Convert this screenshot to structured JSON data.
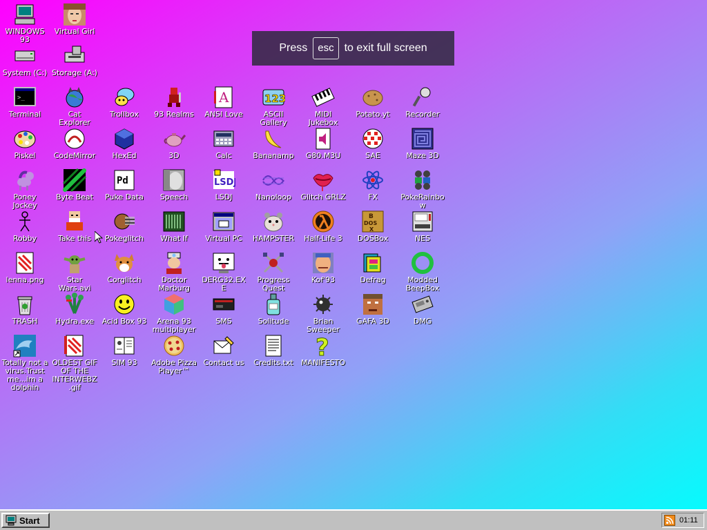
{
  "fullscreen_notice": {
    "prefix": "Press",
    "key": "esc",
    "suffix": "to exit full screen"
  },
  "taskbar": {
    "start_label": "Start",
    "clock": "01:11"
  },
  "desktop_icons": [
    {
      "name": "icon-windows93",
      "label": "WINDOWS 93",
      "icon": "computer-icon"
    },
    {
      "name": "icon-virtual-girl",
      "label": "Virtual Girl",
      "icon": "girl-face-icon"
    },
    {
      "name": "icon-system-c",
      "label": "System (C:)",
      "icon": "hard-drive-icon"
    },
    {
      "name": "icon-storage-a",
      "label": "Storage (A:)",
      "icon": "floppy-drive-icon"
    },
    {
      "name": "icon-terminal",
      "label": "Terminal",
      "icon": "terminal-icon"
    },
    {
      "name": "icon-cat-explorer",
      "label": "Cat Explorer",
      "icon": "cat-globe-icon"
    },
    {
      "name": "icon-trollbox",
      "label": "Trollbox",
      "icon": "chat-bubble-icon"
    },
    {
      "name": "icon-93-realms",
      "label": "93 Realms",
      "icon": "knight-icon"
    },
    {
      "name": "icon-ansi-love",
      "label": "ANSI Love",
      "icon": "ansi-letter-icon"
    },
    {
      "name": "icon-ascii-gallery",
      "label": "ASCII Gallery",
      "icon": "ascii-123-icon"
    },
    {
      "name": "icon-midi-jukebox",
      "label": "MIDI Jukebox",
      "icon": "piano-keys-icon"
    },
    {
      "name": "icon-potato-yt",
      "label": "Potato.yt",
      "icon": "potato-icon"
    },
    {
      "name": "icon-recorder",
      "label": "Recorder",
      "icon": "microphone-icon"
    },
    {
      "name": "icon-piskel",
      "label": "Piskel",
      "icon": "palette-icon"
    },
    {
      "name": "icon-codemirror",
      "label": "CodeMirror",
      "icon": "codemirror-icon"
    },
    {
      "name": "icon-hexed",
      "label": "HexEd",
      "icon": "hex-cube-icon"
    },
    {
      "name": "icon-3d",
      "label": "3D",
      "icon": "teapot-icon"
    },
    {
      "name": "icon-calc",
      "label": "Calc",
      "icon": "calculator-icon"
    },
    {
      "name": "icon-bananamp",
      "label": "Bananamp",
      "icon": "banana-icon"
    },
    {
      "name": "icon-g80-m3u",
      "label": "G80.M3U",
      "icon": "audio-file-icon"
    },
    {
      "name": "icon-sae",
      "label": "SAE",
      "icon": "checkered-ball-icon"
    },
    {
      "name": "icon-maze-3d",
      "label": "Maze 3D",
      "icon": "maze-icon"
    },
    {
      "name": "icon-poney-jockey",
      "label": "Poney Jockey",
      "icon": "pony-icon"
    },
    {
      "name": "icon-byte-beat",
      "label": "Byte Beat",
      "icon": "byte-beat-icon"
    },
    {
      "name": "icon-puke-data",
      "label": "Puke Data",
      "icon": "pd-icon"
    },
    {
      "name": "icon-speech",
      "label": "Speech",
      "icon": "speech-face-icon"
    },
    {
      "name": "icon-lsdj",
      "label": "LSDJ",
      "icon": "lsdj-icon"
    },
    {
      "name": "icon-nanoloop",
      "label": "Nanoloop",
      "icon": "wave-icon"
    },
    {
      "name": "icon-glitch-grlz",
      "label": "Glitch GRLZ",
      "icon": "lips-icon"
    },
    {
      "name": "icon-fx",
      "label": "FX",
      "icon": "atom-icon"
    },
    {
      "name": "icon-pokerainbow",
      "label": "PokeRainbow",
      "icon": "trainers-icon"
    },
    {
      "name": "icon-robby",
      "label": "Robby",
      "icon": "stick-figure-icon"
    },
    {
      "name": "icon-take-this",
      "label": "Take this",
      "icon": "old-man-icon"
    },
    {
      "name": "icon-pokeglitch",
      "label": "Pokeglitch",
      "icon": "glitch-pokemon-icon"
    },
    {
      "name": "icon-what-if",
      "label": "What If",
      "icon": "what-if-icon"
    },
    {
      "name": "icon-virtual-pc",
      "label": "Virtual PC",
      "icon": "window-icon"
    },
    {
      "name": "icon-hampster",
      "label": "HAMPSTER",
      "icon": "hamster-icon"
    },
    {
      "name": "icon-half-life-3",
      "label": "Half-Life 3",
      "icon": "lambda-icon"
    },
    {
      "name": "icon-dosbox",
      "label": "DOSBox",
      "icon": "dosbox-icon"
    },
    {
      "name": "icon-nes",
      "label": "NES",
      "icon": "nes-console-icon"
    },
    {
      "name": "icon-lenna-png",
      "label": "lenna.png",
      "icon": "image-file-icon"
    },
    {
      "name": "icon-star-wars-avi",
      "label": "Star Wars.avi",
      "icon": "yoda-icon"
    },
    {
      "name": "icon-corglitch",
      "label": "Corglitch",
      "icon": "corgi-icon"
    },
    {
      "name": "icon-doctor-marburg",
      "label": "Doctor Marburg",
      "icon": "doctor-icon"
    },
    {
      "name": "icon-derg32-exe",
      "label": "DERG32.EXE",
      "icon": "tongue-monitor-icon"
    },
    {
      "name": "icon-progress-quest",
      "label": "Progress Quest",
      "icon": "crossed-swords-icon"
    },
    {
      "name": "icon-kof93",
      "label": "Kof'93",
      "icon": "fighter-icon"
    },
    {
      "name": "icon-defrag",
      "label": "Defrag",
      "icon": "defrag-icon"
    },
    {
      "name": "icon-modded-beepbox",
      "label": "Modded BeepBox",
      "icon": "green-ring-icon"
    },
    {
      "name": "icon-trash",
      "label": "TRASH",
      "icon": "trash-icon"
    },
    {
      "name": "icon-hydra-exe",
      "label": "Hydra.exe",
      "icon": "hydra-icon"
    },
    {
      "name": "icon-acid-box-93",
      "label": "Acid Box 93",
      "icon": "smiley-icon"
    },
    {
      "name": "icon-arena-93",
      "label": "Arena 93 multiplayer",
      "icon": "cube-icon"
    },
    {
      "name": "icon-sms",
      "label": "SMS",
      "icon": "sms-console-icon"
    },
    {
      "name": "icon-solitude",
      "label": "Solitude",
      "icon": "bottle-icon"
    },
    {
      "name": "icon-brian-sweeper",
      "label": "Brian Sweeper",
      "icon": "mine-icon"
    },
    {
      "name": "icon-gafa-3d",
      "label": "GAFA 3D",
      "icon": "doom-face-icon"
    },
    {
      "name": "icon-dmg",
      "label": "DMG",
      "icon": "dmg-icon"
    },
    {
      "name": "icon-dolphin",
      "label": "Totally not a virus.Trust me...im a dolphin",
      "icon": "dolphin-icon"
    },
    {
      "name": "icon-oldest-gif",
      "label": "OLDEST GIF OF THE INTERWEBZ.gif",
      "icon": "gif-file-icon"
    },
    {
      "name": "icon-sim-93",
      "label": "SIM 93",
      "icon": "book-icon"
    },
    {
      "name": "icon-adobe-pizza",
      "label": "Adobe Pizza Player™",
      "icon": "pizza-icon"
    },
    {
      "name": "icon-contact-us",
      "label": "Contact us",
      "icon": "envelope-icon"
    },
    {
      "name": "icon-credits",
      "label": "Credits.txt",
      "icon": "text-file-icon"
    },
    {
      "name": "icon-manifesto",
      "label": "MANIFESTO",
      "icon": "question-mark-icon"
    }
  ]
}
